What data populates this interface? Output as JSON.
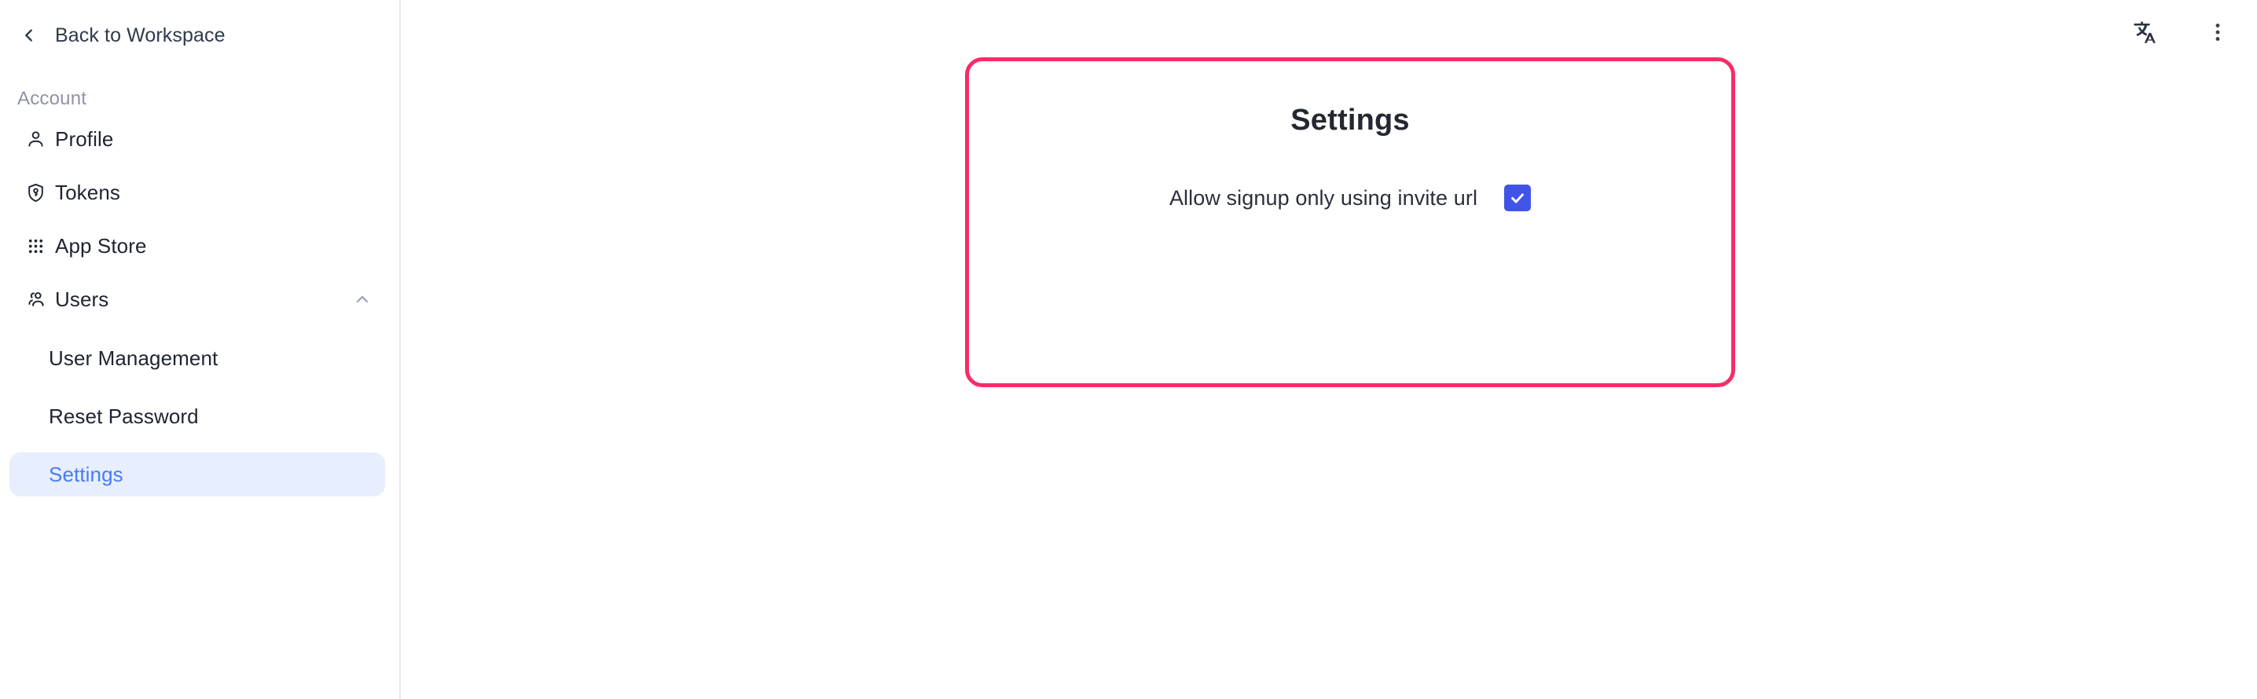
{
  "sidebar": {
    "back": {
      "label": "Back to Workspace",
      "icon": "chevron-left-icon"
    },
    "section_label": "Account",
    "items": [
      {
        "label": "Profile",
        "icon": "person-icon",
        "active": false
      },
      {
        "label": "Tokens",
        "icon": "shield-key-icon",
        "active": false
      },
      {
        "label": "App Store",
        "icon": "grid-dots-icon",
        "active": false
      },
      {
        "label": "Users",
        "icon": "people-icon",
        "active": false,
        "expanded": true,
        "chevron": "chevron-up-icon"
      }
    ],
    "sub_items": [
      {
        "label": "User Management",
        "active": false
      },
      {
        "label": "Reset Password",
        "active": false
      },
      {
        "label": "Settings",
        "active": true
      }
    ]
  },
  "topbar": {
    "translate_button": {
      "label": "文",
      "sub": "A",
      "icon": "translate-icon"
    },
    "more_button": {
      "icon": "more-vertical-icon"
    }
  },
  "card": {
    "title": "Settings",
    "option": {
      "label": "Allow signup only using invite url",
      "checked": true
    }
  },
  "colors": {
    "card_border": "#f72c68",
    "checkbox": "#4154e8",
    "active_item_bg": "#e7eefd",
    "active_item_text": "#477bfb",
    "sidebar_border": "#e6e8ec"
  }
}
